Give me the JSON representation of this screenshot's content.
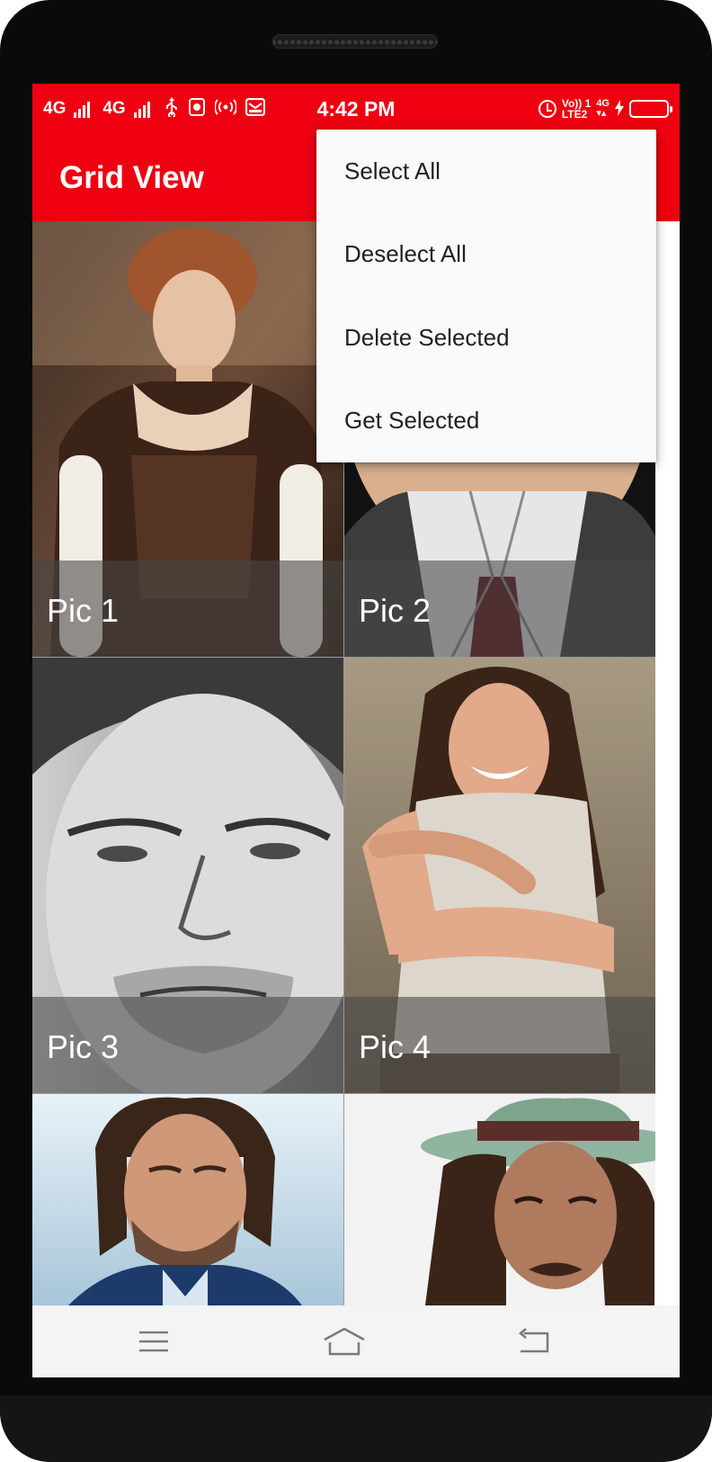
{
  "status_bar": {
    "net1": "4G",
    "net2": "4G",
    "time": "4:42 PM",
    "volte_top": "Vo)) 1",
    "volte_bottom": "LTE2",
    "net_right": "4G"
  },
  "toolbar": {
    "title": "Grid View"
  },
  "grid": {
    "tiles": [
      {
        "caption": "Pic 1",
        "theme": "warm-portrait"
      },
      {
        "caption": "Pic 2",
        "theme": "suit-portrait"
      },
      {
        "caption": "Pic 3",
        "theme": "grayscale-portrait"
      },
      {
        "caption": "Pic 4",
        "theme": "smiling-portrait"
      },
      {
        "caption": "",
        "theme": "bearded-portrait"
      },
      {
        "caption": "",
        "theme": "hat-portrait"
      }
    ]
  },
  "menu": {
    "items": [
      "Select All",
      "Deselect All",
      "Delete Selected",
      "Get Selected"
    ]
  },
  "nav_bar": {
    "icons": [
      "menu-icon",
      "home-icon",
      "back-icon"
    ]
  },
  "colors": {
    "accent": "#ee0011",
    "menu_bg": "#fafafa",
    "nav_bg": "#f4f4f4",
    "frame": "#0a0a0a"
  }
}
